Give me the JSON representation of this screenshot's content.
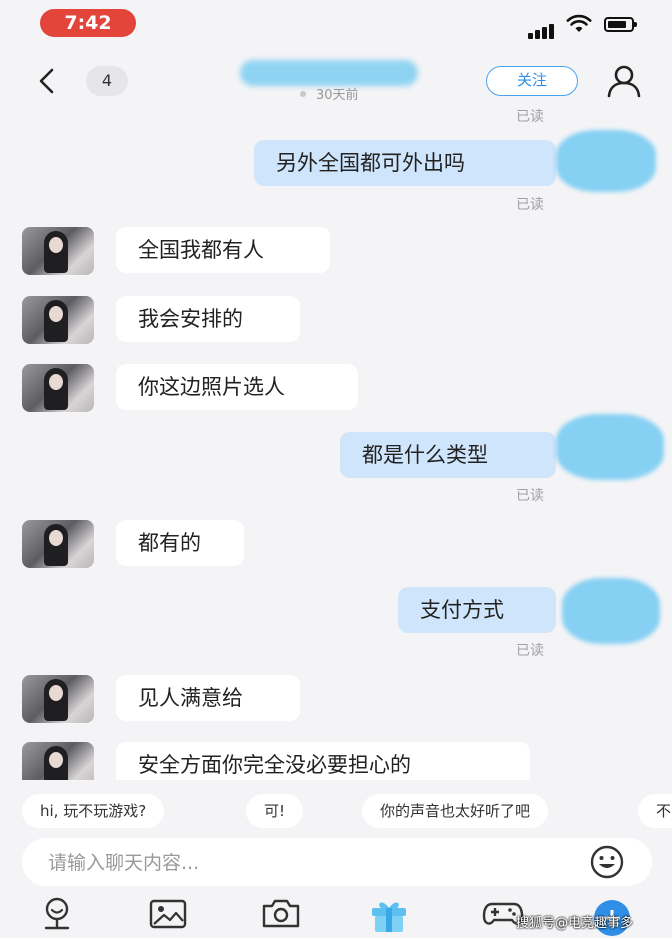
{
  "status_bar": {
    "time": "7:42"
  },
  "header": {
    "unread_count": "4",
    "last_seen": "30天前",
    "follow_label": "关注"
  },
  "messages": [
    {
      "side": "out",
      "text": "另外全国都可外出吗",
      "read": "已读"
    },
    {
      "side": "in",
      "text": "全国我都有人"
    },
    {
      "side": "in",
      "text": "我会安排的"
    },
    {
      "side": "in",
      "text": "你这边照片选人"
    },
    {
      "side": "out",
      "text": "都是什么类型",
      "read": "已读"
    },
    {
      "side": "in",
      "text": "都有的"
    },
    {
      "side": "out",
      "text": "支付方式",
      "read": "已读"
    },
    {
      "side": "in",
      "text": "见人满意给"
    },
    {
      "side": "in",
      "text": "安全方面你完全没必要担心的"
    }
  ],
  "top_read_label": "已读",
  "quick_replies": [
    "hi, 玩不玩游戏?",
    "可!",
    "你的声音也太好听了吧",
    "不"
  ],
  "input": {
    "placeholder": "请输入聊天内容..."
  },
  "toolbar_icons": [
    "voice-icon",
    "image-icon",
    "camera-icon",
    "gift-icon",
    "game-icon"
  ],
  "watermark": "搜狐号@电竞趣事多",
  "colors": {
    "accent": "#2f8ee6",
    "out_bubble": "#cfe5fb",
    "in_bubble": "#ffffff",
    "time_pill": "#e3453b"
  }
}
